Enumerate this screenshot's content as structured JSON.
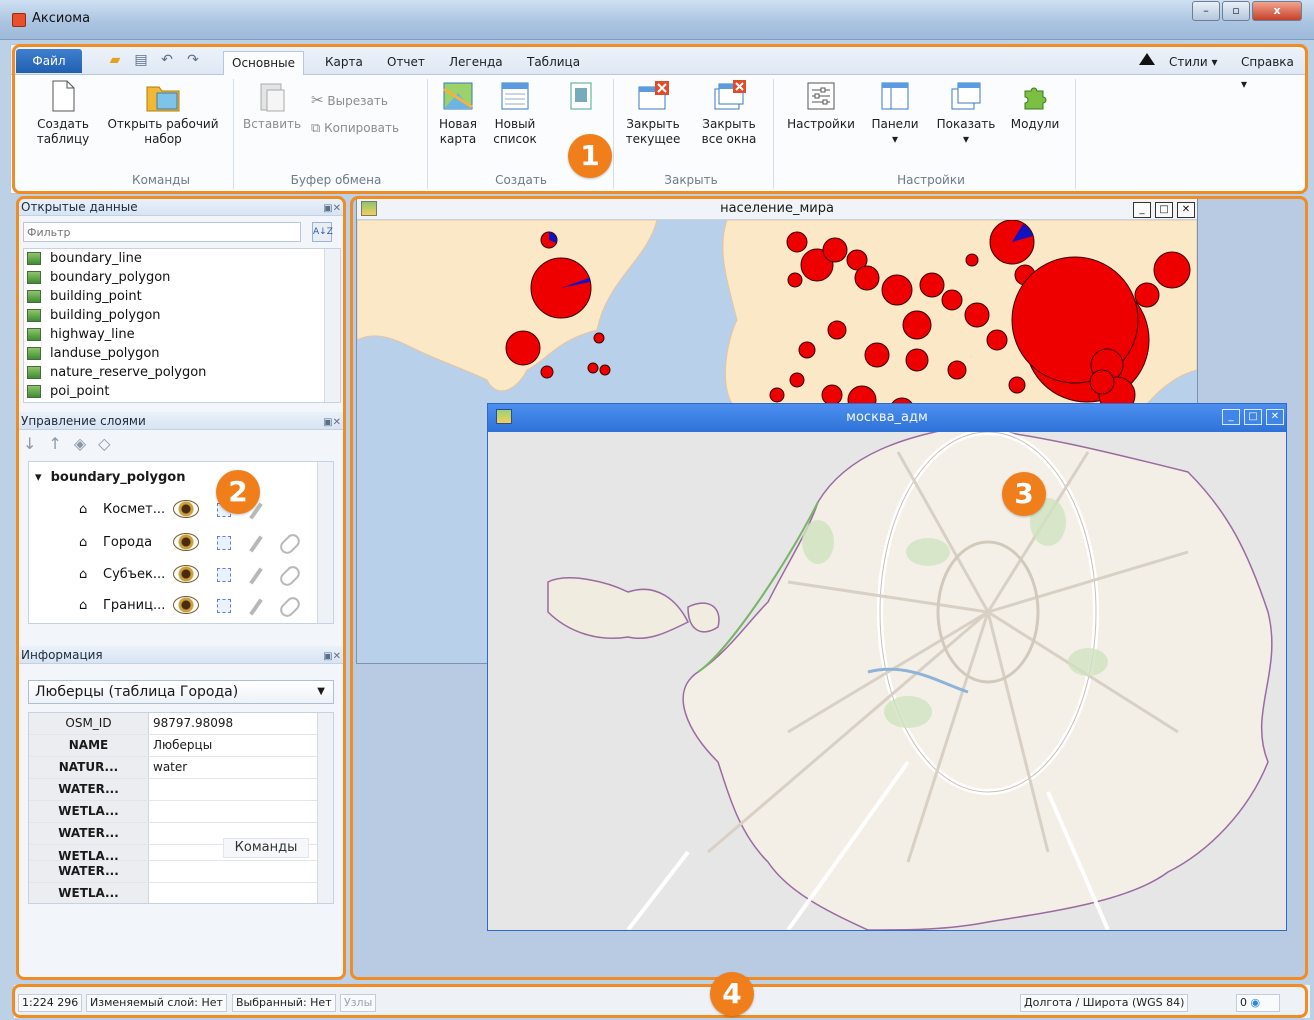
{
  "window": {
    "title": "Аксиома",
    "minimize": "–",
    "maximize": "▫",
    "close": "x"
  },
  "ribbon": {
    "file_tab": "Файл",
    "tabs": [
      "Основные",
      "Карта",
      "Отчет",
      "Легенда",
      "Таблица"
    ],
    "right": {
      "styles": "Стили ▾",
      "help": "Справка ▾"
    },
    "buttons": {
      "create_table": "Создать таблицу",
      "open_workset": "Открыть рабочий набор",
      "paste": "Вставить",
      "cut": "Вырезать",
      "copy": "Копировать",
      "new_map": "Новая карта",
      "new_list": "Новый список",
      "close_current": "Закрыть текущее",
      "close_all": "Закрыть все окна",
      "settings": "Настройки",
      "panels": "Панели ▾",
      "show": "Показать ▾",
      "modules": "Модули"
    },
    "groups": {
      "commands": "Команды",
      "clipboard": "Буфер обмена",
      "create": "Создать",
      "close": "Закрыть",
      "settings": "Настройки"
    }
  },
  "open_data": {
    "header": "Открытые данные",
    "filter_placeholder": "Фильтр",
    "sort_icon": "A-Z sort icon",
    "items": [
      "boundary_line",
      "boundary_polygon",
      "building_point",
      "building_polygon",
      "highway_line",
      "landuse_polygon",
      "nature_reserve_polygon",
      "poi_point"
    ]
  },
  "layers": {
    "header": "Управление слоями",
    "group": "boundary_polygon",
    "rows": [
      "Космет...",
      "Города",
      "Субъек...",
      "Границ..."
    ]
  },
  "info": {
    "header": "Информация",
    "selected": "Люберцы (таблица Города)",
    "rows": [
      {
        "key": "OSM_ID",
        "value": "98797.98098"
      },
      {
        "key": "NAME",
        "value": "Люберцы"
      },
      {
        "key": "NATUR...",
        "value": "water"
      },
      {
        "key": "WATER...",
        "value": ""
      },
      {
        "key": "WETLA...",
        "value": ""
      },
      {
        "key": "WATER...",
        "value": ""
      },
      {
        "key": "WETLA...",
        "value": ""
      },
      {
        "key": "WATER...",
        "value": ""
      },
      {
        "key": "WETLA...",
        "value": ""
      }
    ],
    "tooltip": "Команды"
  },
  "map_windows": {
    "world": "население_мира",
    "moscow": "москва_адм"
  },
  "status": {
    "scale": "1:224 296",
    "editable_layer": "Изменяемый слой: Нет",
    "selected": "Выбранный: Нет",
    "nodes": "Узлы",
    "crs": "Долгота / Широта (WGS 84)",
    "count": "0"
  },
  "callouts": [
    "1",
    "2",
    "3",
    "4"
  ],
  "colors": {
    "accent": "#f07e1b",
    "file_tab": "#215fb0",
    "active_window": "#2f73d8"
  }
}
